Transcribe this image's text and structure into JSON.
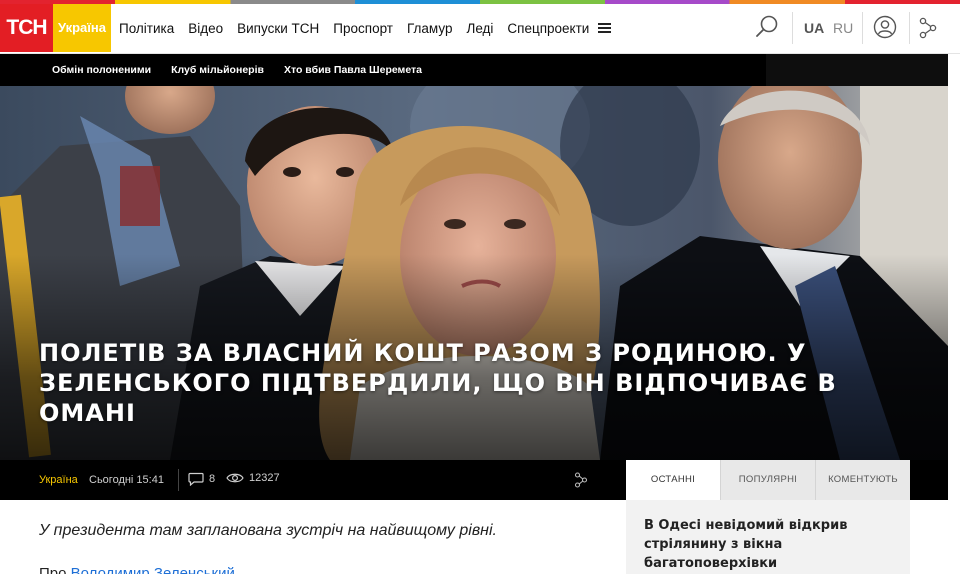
{
  "brand": {
    "logo_text": "ТСН",
    "region_label": "Україна",
    "accent_color": "#e31e24",
    "region_color": "#f7c700"
  },
  "nav": {
    "items": [
      "Політика",
      "Відео",
      "Випуски ТСН",
      "Проспорт",
      "Гламур",
      "Леді",
      "Спецпроекти"
    ],
    "menu_icon": "hamburger-icon",
    "search_icon": "search-icon",
    "languages": {
      "active": "UA",
      "other": "RU"
    },
    "user_icon": "user-icon",
    "share_icon": "share-icon"
  },
  "tagbar": {
    "tags": [
      "Обмін полоненими",
      "Клуб мільйонерів",
      "Хто вбив Павла Шеремета"
    ]
  },
  "article": {
    "headline": "ПОЛЕТІВ ЗА ВЛАСНИЙ КОШТ РАЗОМ З РОДИНОЮ. У ЗЕЛЕНСЬКОГО ПІДТВЕРДИЛИ, ЩО ВІН ВІДПОЧИВАЄ В ОМАНІ",
    "region": "Україна",
    "date": "Сьогодні 15:41",
    "comments_count": "8",
    "views_count": "12327",
    "lead": "У президента там запланована зустріч на найвищому рівні.",
    "paragraph_start": "Про",
    "paragraph_link": "Володимир Зеленський"
  },
  "sidebar": {
    "tabs": [
      "ОСТАННІ",
      "ПОПУЛЯРНІ",
      "КОМЕНТУЮТЬ"
    ],
    "active_tab": 0,
    "latest_title": "В Одесі невідомий відкрив стрілянину з вікна багатоповерхівки"
  }
}
